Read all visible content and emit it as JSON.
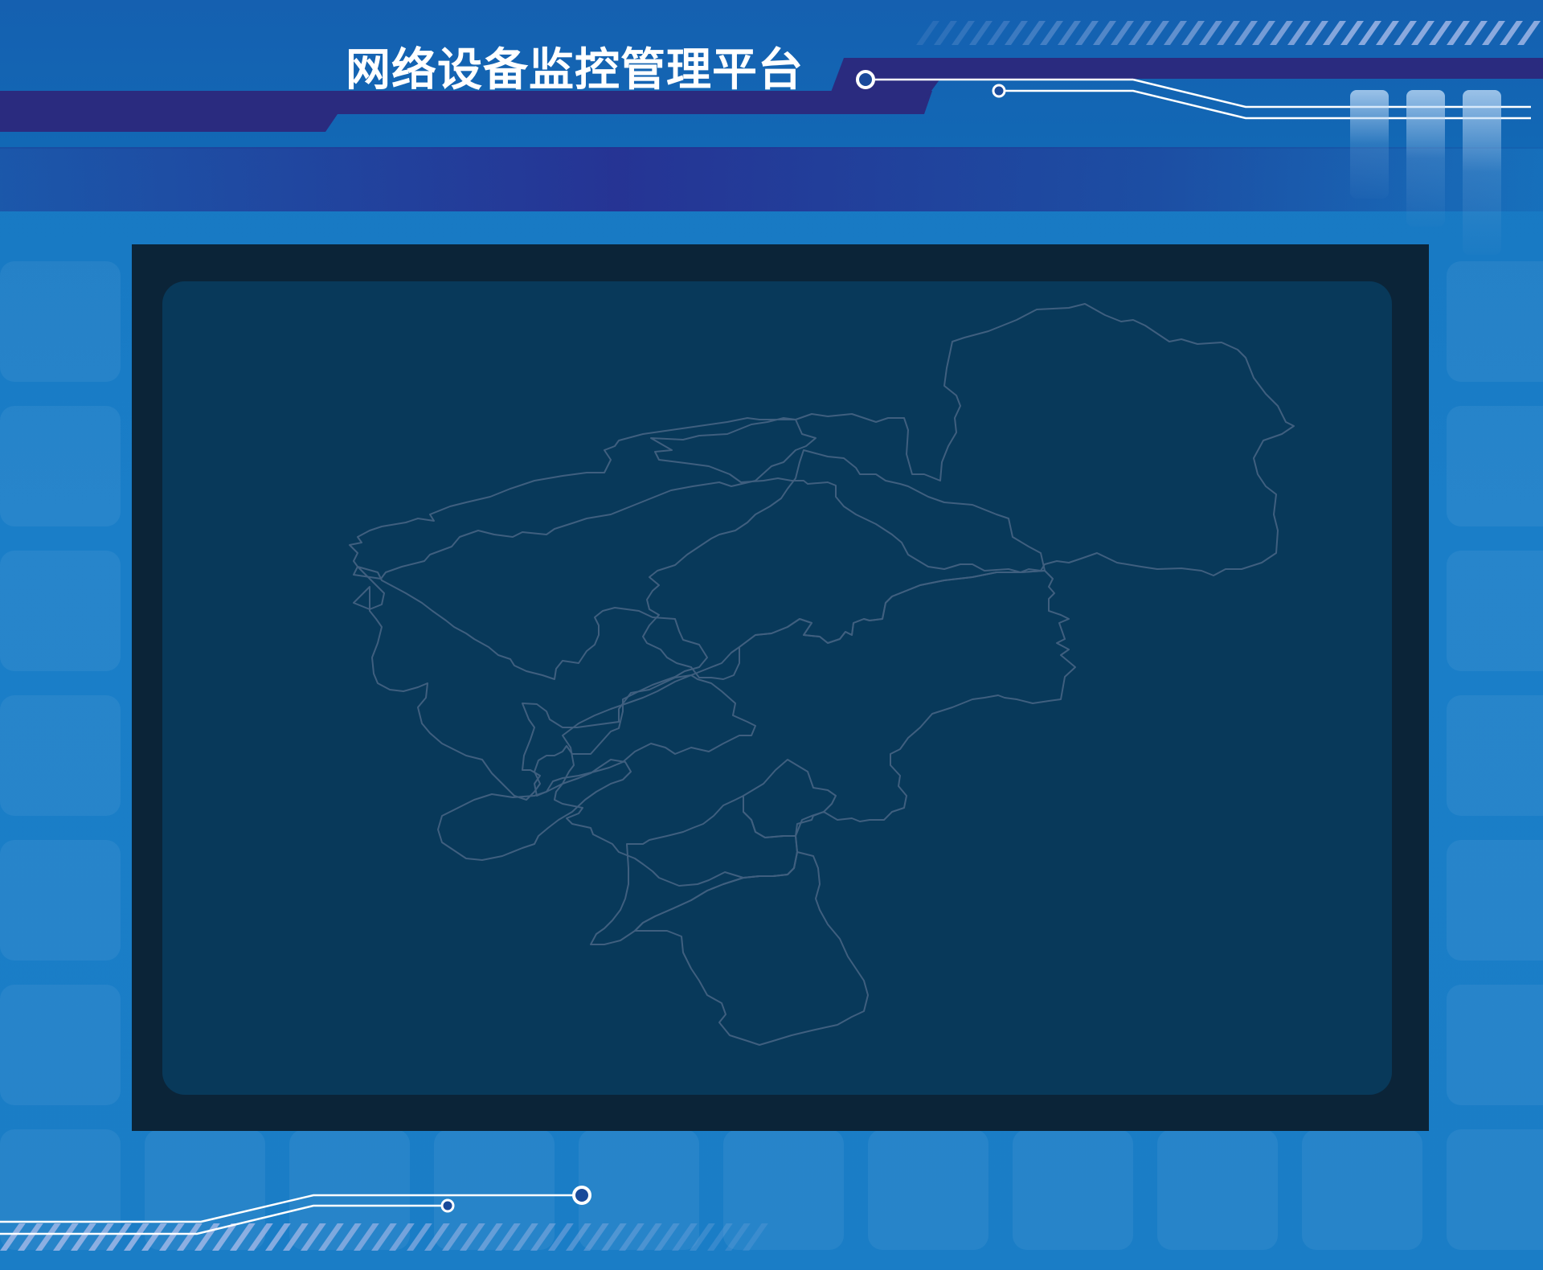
{
  "header": {
    "title": "网络设备监控管理平台"
  },
  "colors": {
    "background": "#1a7dc6",
    "header_band": "#2a2b7f",
    "frame_outer": "#0b2438",
    "frame_inner": "#08395a",
    "map_stroke": "#3f5f7f",
    "circuit_line": "#ffffff",
    "stripe": "#9fb6e6"
  },
  "map": {
    "region_count": 10
  }
}
